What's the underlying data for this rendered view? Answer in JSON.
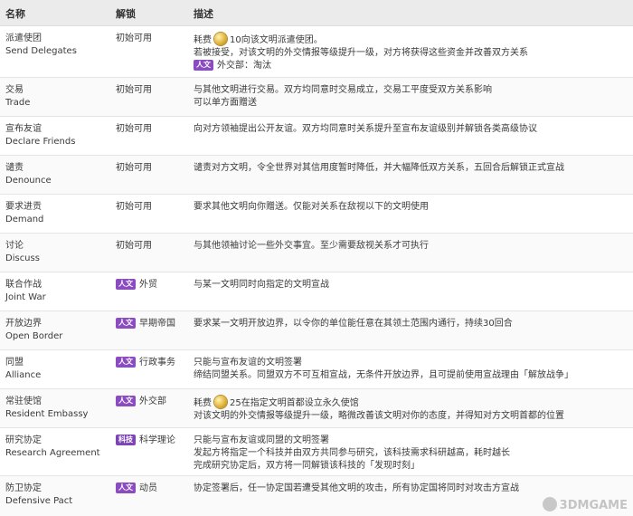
{
  "headers": {
    "name": "名称",
    "unlock": "解锁",
    "desc": "描述"
  },
  "rows": [
    {
      "name_cn": "派遣使团",
      "name_en": "Send Delegates",
      "unlock": "初始可用",
      "desc1_pre": "耗费",
      "desc1_post": "10向该文明派遣使团。",
      "desc2": "若被接受，对该文明的外交情报等级提升一级，对方将获得这些资金并改善双方关系",
      "badge3": "人文",
      "desc3": "外交部：淘汰"
    },
    {
      "name_cn": "交易",
      "name_en": "Trade",
      "unlock": "初始可用",
      "desc1": "与其他文明进行交易。双方均同意时交易成立，交易工平度受双方关系影响",
      "desc2": "可以单方面赠送"
    },
    {
      "name_cn": "宣布友谊",
      "name_en": "Declare Friends",
      "unlock": "初始可用",
      "desc1": "向对方领袖提出公开友谊。双方均同意时关系提升至宣布友谊级别并解锁各类高级协议"
    },
    {
      "name_cn": "谴责",
      "name_en": "Denounce",
      "unlock": "初始可用",
      "desc1": "谴责对方文明，令全世界对其信用度暂时降低，并大幅降低双方关系，五回合后解锁正式宣战"
    },
    {
      "name_cn": "要求进贡",
      "name_en": "Demand",
      "unlock": "初始可用",
      "desc1": "要求其他文明向你赠送。仅能对关系在敌视以下的文明使用"
    },
    {
      "name_cn": "讨论",
      "name_en": "Discuss",
      "unlock": "初始可用",
      "desc1": "与其他领袖讨论一些外交事宜。至少需要敌视关系才可执行"
    },
    {
      "name_cn": "联合作战",
      "name_en": "Joint War",
      "unlock_badge": "人文",
      "unlock": "外贸",
      "desc1": "与某一文明同时向指定的文明宣战"
    },
    {
      "name_cn": "开放边界",
      "name_en": "Open Border",
      "unlock_badge": "人文",
      "unlock": "早期帝国",
      "desc1": "要求某一文明开放边界，以令你的单位能任意在其领土范围内通行，持续30回合"
    },
    {
      "name_cn": "同盟",
      "name_en": "Alliance",
      "unlock_badge": "人文",
      "unlock": "行政事务",
      "desc1": "只能与宣布友谊的文明签署",
      "desc2": "缔结同盟关系。同盟双方不可互相宣战，无条件开放边界，且可提前使用宣战理由「解放战争」"
    },
    {
      "name_cn": "常驻使馆",
      "name_en": "Resident Embassy",
      "unlock_badge": "人文",
      "unlock": "外交部",
      "desc1_pre": "耗费",
      "desc1_post": "25在指定文明首都设立永久使馆",
      "desc2": "对该文明的外交情报等级提升一级，略微改善该文明对你的态度，并得知对方文明首都的位置"
    },
    {
      "name_cn": "研究协定",
      "name_en": "Research Agreement",
      "unlock_badge": "科技",
      "unlock": "科学理论",
      "desc1": "只能与宣布友谊或同盟的文明签署",
      "desc2": "发起方将指定一个科技并由双方共同参与研究，该科技需求科研越高，耗时越长",
      "desc3": "完成研究协定后，双方将一同解锁该科技的「发现时刻」"
    },
    {
      "name_cn": "防卫协定",
      "name_en": "Defensive Pact",
      "unlock_badge": "人文",
      "unlock": "动员",
      "desc1": "协定签署后，任一协定国若遭受其他文明的攻击，所有协定国将同时对攻击方宣战"
    }
  ],
  "watermark": "3DMGAME"
}
